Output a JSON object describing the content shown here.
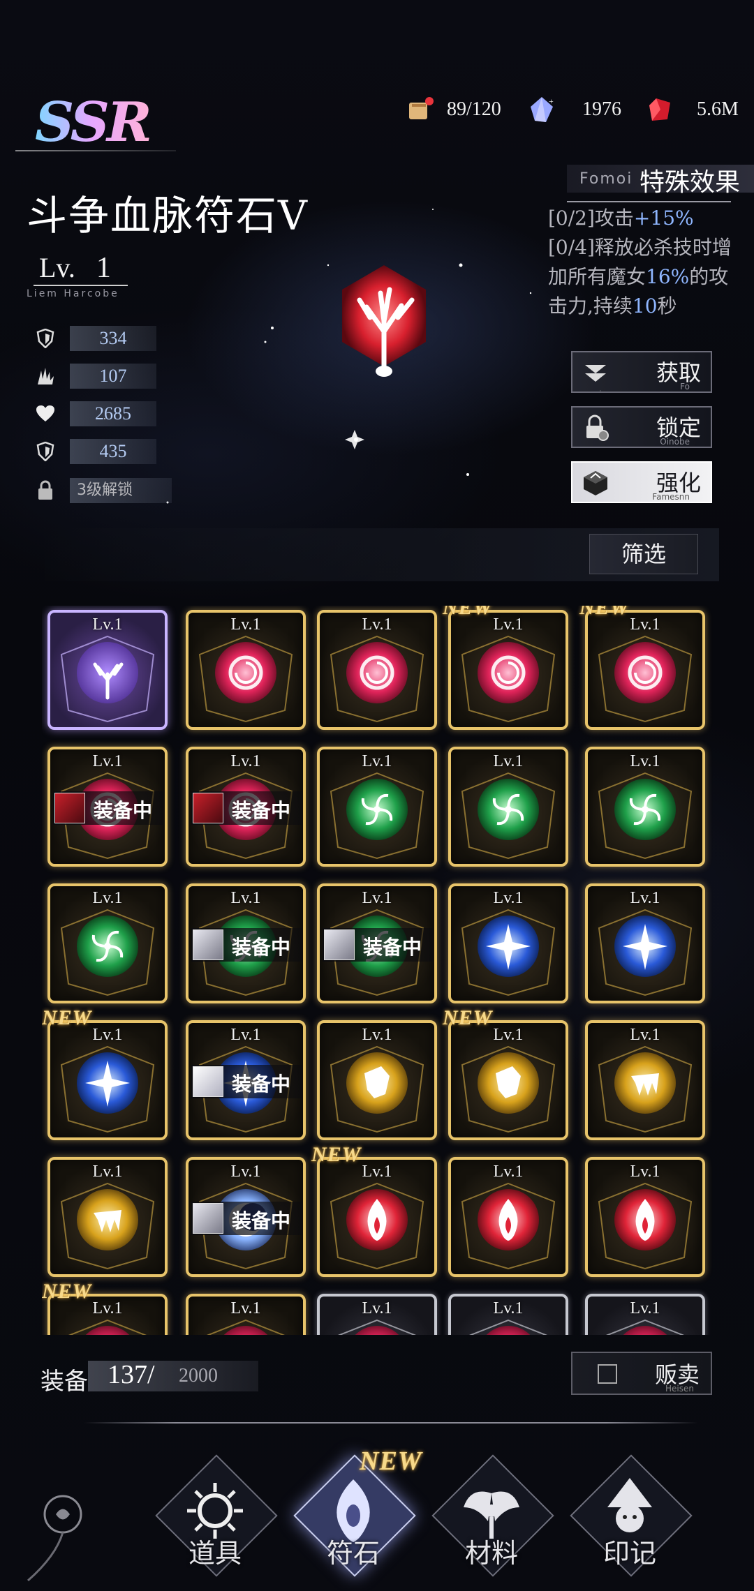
{
  "rarity": "SSR",
  "resources": [
    {
      "icon": "stamina-book-icon",
      "value": "89/120"
    },
    {
      "icon": "crystal-icon",
      "value": "1976"
    },
    {
      "icon": "ruby-icon",
      "value": "5.6M"
    }
  ],
  "item": {
    "name": "斗争血脉符石Ⅴ",
    "level_label": "Lv.",
    "level": "1",
    "level_subtitle": "Liem Harcobe",
    "stats": [
      {
        "icon": "defense-shield-icon",
        "value": "334"
      },
      {
        "icon": "attack-claw-icon",
        "value": "107"
      },
      {
        "icon": "hp-heart-icon",
        "value": "2685"
      },
      {
        "icon": "defense-shield-icon",
        "value": "435"
      },
      {
        "icon": "lock-icon",
        "value": "3级解锁"
      }
    ]
  },
  "special_effect": {
    "subtitle": "Fomoi",
    "title": "特殊效果",
    "line1_prefix": "[0/2]攻击",
    "line1_value": "+15%",
    "line2_a": "[0/4]释放必杀技时增加所有魔女",
    "line2_value": "16%",
    "line2_b": "的攻击力,持续",
    "line2_value2": "10",
    "line2_c": "秒"
  },
  "actions": [
    {
      "label": "获取",
      "sub": "Fo",
      "icon": "chevron-down-double-icon"
    },
    {
      "label": "锁定",
      "sub": "Oinobe",
      "icon": "lock-gear-icon"
    },
    {
      "label": "强化",
      "sub": "Famesnn",
      "icon": "upgrade-cube-icon"
    }
  ],
  "filter_label": "筛选",
  "equipped_label": "装备中",
  "new_label": "NEW",
  "grid": [
    [
      {
        "lv": "Lv.1",
        "type": "tree",
        "rarity": "purple"
      },
      {
        "lv": "Lv.1",
        "type": "red-swirl"
      },
      {
        "lv": "Lv.1",
        "type": "red-swirl"
      },
      {
        "lv": "Lv.1",
        "type": "red-swirl",
        "new": true
      },
      {
        "lv": "Lv.1",
        "type": "red-swirl",
        "new": true
      }
    ],
    [
      {
        "lv": "Lv.1",
        "type": "red-swirl",
        "equipped": "red"
      },
      {
        "lv": "Lv.1",
        "type": "red-swirl",
        "equipped": "red"
      },
      {
        "lv": "Lv.1",
        "type": "green-wind"
      },
      {
        "lv": "Lv.1",
        "type": "green-wind"
      },
      {
        "lv": "Lv.1",
        "type": "green-wind"
      }
    ],
    [
      {
        "lv": "Lv.1",
        "type": "green-wind"
      },
      {
        "lv": "Lv.1",
        "type": "green-wind",
        "equipped": "silver"
      },
      {
        "lv": "Lv.1",
        "type": "green-wind",
        "equipped": "silver"
      },
      {
        "lv": "Lv.1",
        "type": "blue-cross"
      },
      {
        "lv": "Lv.1",
        "type": "blue-cross"
      }
    ],
    [
      {
        "lv": "Lv.1",
        "type": "blue-cross",
        "new": true
      },
      {
        "lv": "Lv.1",
        "type": "blue-cross",
        "equipped": "white"
      },
      {
        "lv": "Lv.1",
        "type": "gold-fist"
      },
      {
        "lv": "Lv.1",
        "type": "gold-fist",
        "new": true
      },
      {
        "lv": "Lv.1",
        "type": "gold-fang"
      }
    ],
    [
      {
        "lv": "Lv.1",
        "type": "gold-fang"
      },
      {
        "lv": "Lv.1",
        "type": "blue-moon",
        "equipped": "silver"
      },
      {
        "lv": "Lv.1",
        "type": "red-flame",
        "new": true
      },
      {
        "lv": "Lv.1",
        "type": "red-flame"
      },
      {
        "lv": "Lv.1",
        "type": "red-flame"
      }
    ],
    [
      {
        "lv": "Lv.1",
        "type": "red-swirl",
        "new": true
      },
      {
        "lv": "Lv.1",
        "type": "red-swirl"
      },
      {
        "lv": "Lv.1",
        "type": "red-swirl",
        "rarity": "silver"
      },
      {
        "lv": "Lv.1",
        "type": "red-swirl",
        "rarity": "silver"
      },
      {
        "lv": "Lv.1",
        "type": "red-swirl",
        "rarity": "silver"
      }
    ]
  ],
  "inventory": {
    "label": "装备",
    "current": "137/",
    "max": "2000"
  },
  "sell": {
    "label": "贩卖",
    "sub": "Heisen"
  },
  "bottom_nav": [
    {
      "label": "道具",
      "icon": "item-sun-icon"
    },
    {
      "label": "符石",
      "icon": "rune-eye-icon",
      "active": true,
      "new": true
    },
    {
      "label": "材料",
      "icon": "material-wings-icon"
    },
    {
      "label": "印记",
      "icon": "witch-mark-icon"
    }
  ],
  "colors": {
    "gold_frame": "#e8c46a",
    "accent_blue": "#8fb6ff",
    "stat_blue": "#b4cbf2"
  }
}
